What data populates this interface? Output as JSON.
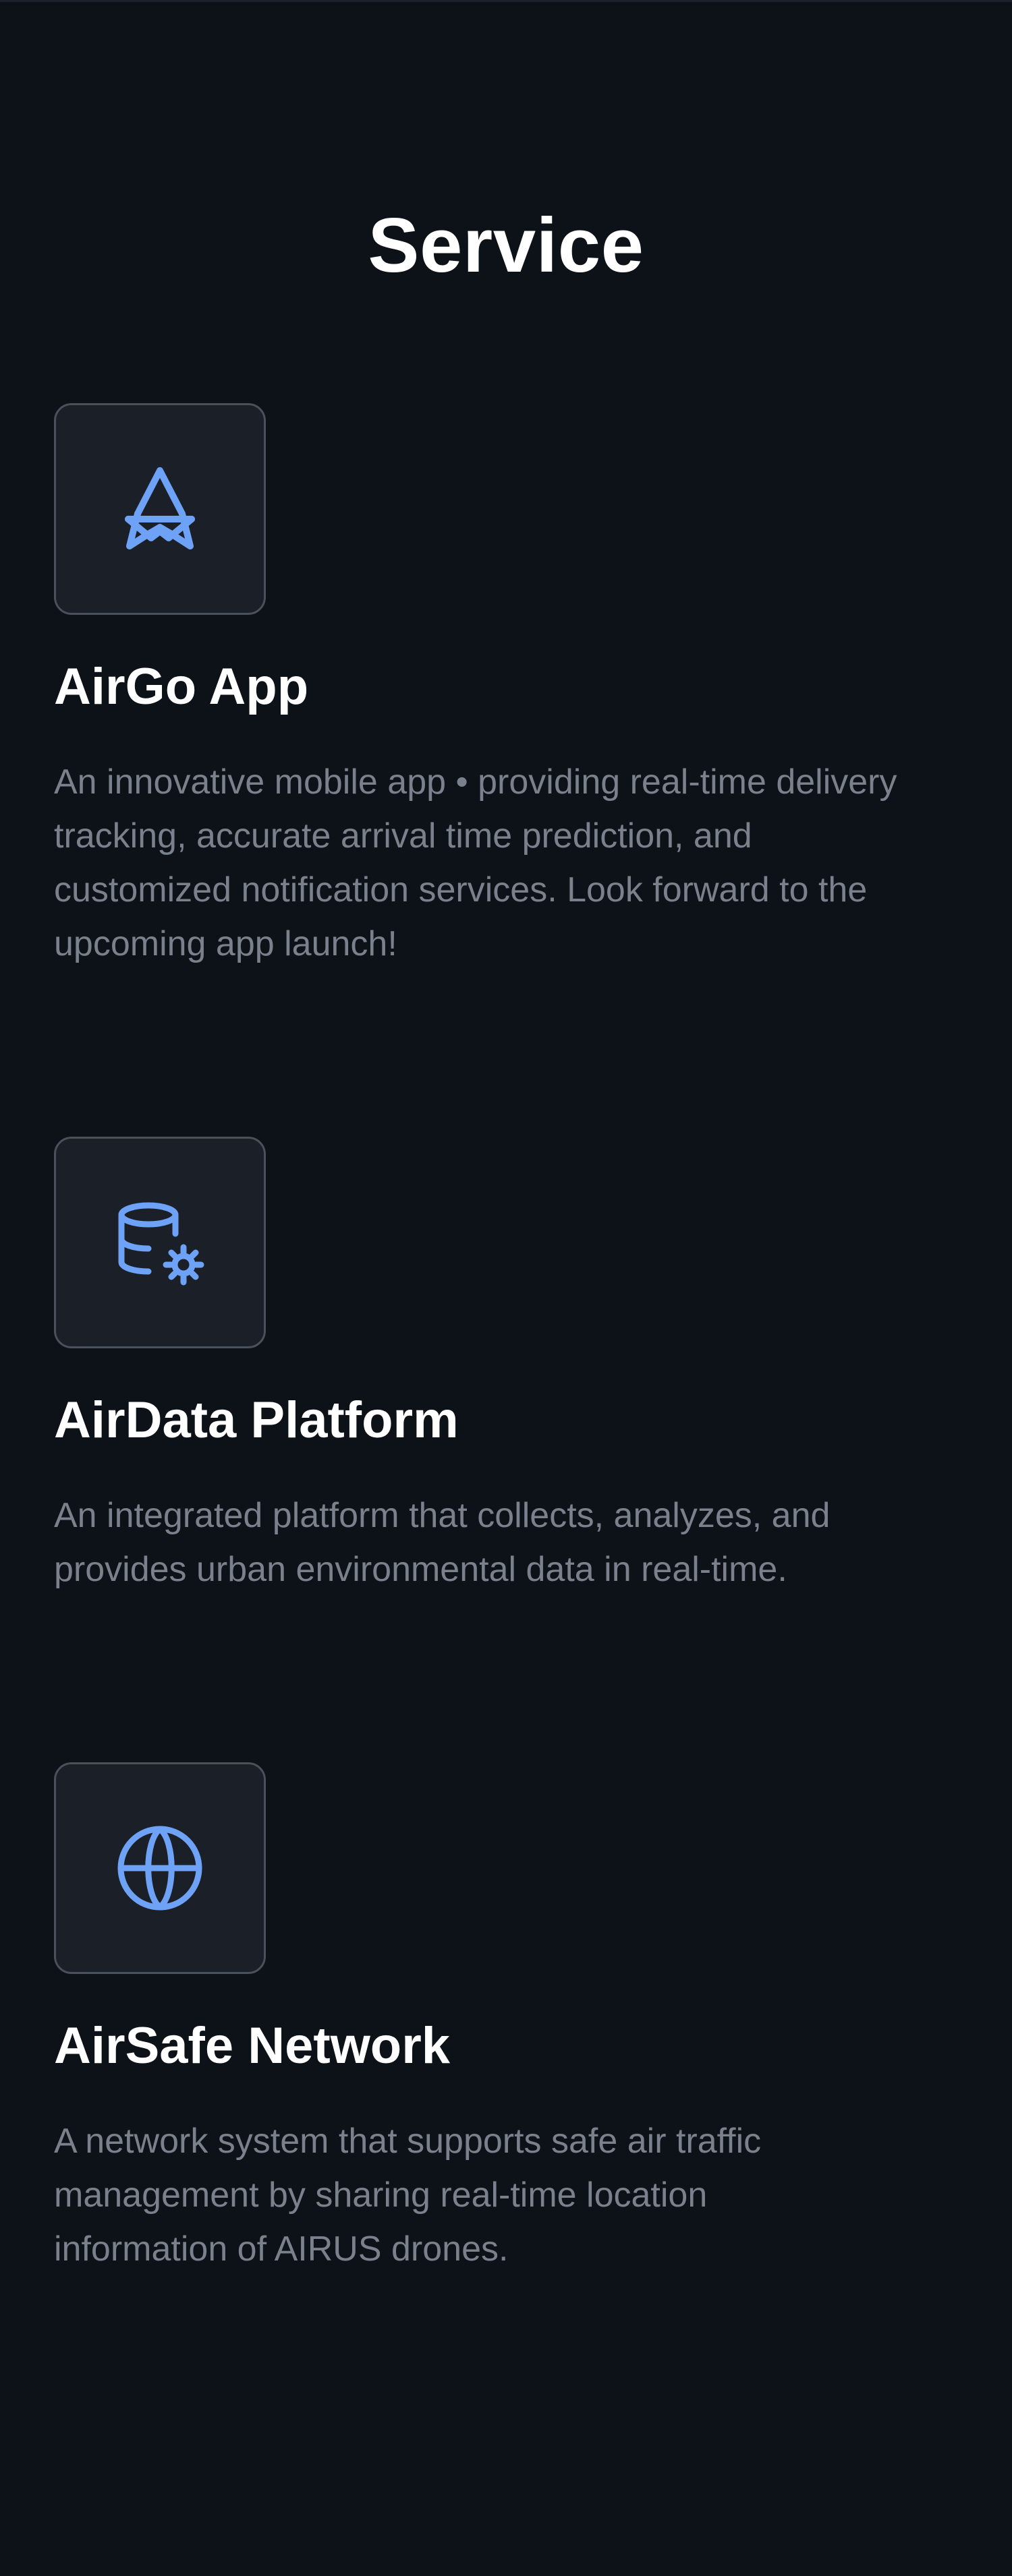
{
  "page": {
    "title": "Service"
  },
  "colors": {
    "background": "#0d1118",
    "card": "#1b1f27",
    "card_border": "#4b515c",
    "icon_accent": "#6ea2f7",
    "text_primary": "#ffffff",
    "text_secondary": "#7b818c"
  },
  "services": [
    {
      "icon": "star-icon",
      "title": "AirGo App",
      "description": "An innovative mobile app • providing real-time delivery\ntracking, accurate arrival time prediction, and\ncustomized notification services. Look forward to the\n upcoming app launch!"
    },
    {
      "icon": "database-settings-icon",
      "title": "AirData Platform",
      "description": "An integrated platform that collects, analyzes, and\nprovides urban environmental data in real-time."
    },
    {
      "icon": "globe-icon",
      "title": "AirSafe Network",
      "description": "A network system that supports safe air traffic\nmanagement by sharing real-time location\ninformation of AIRUS drones."
    }
  ]
}
